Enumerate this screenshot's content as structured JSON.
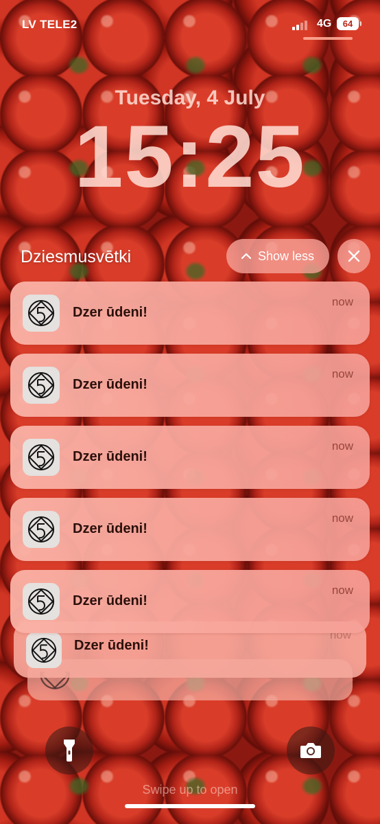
{
  "status_bar": {
    "carrier": "LV TELE2",
    "network": "4G",
    "battery": "64"
  },
  "lock_screen": {
    "date": "Tuesday, 4 July",
    "time": "15:25"
  },
  "notification_group": {
    "app_name": "Dziesmusvētki",
    "show_less_label": "Show less",
    "notifications": [
      {
        "message": "Dzer ūdeni!",
        "time": "now"
      },
      {
        "message": "Dzer ūdeni!",
        "time": "now"
      },
      {
        "message": "Dzer ūdeni!",
        "time": "now"
      },
      {
        "message": "Dzer ūdeni!",
        "time": "now"
      },
      {
        "message": "Dzer ūdeni!",
        "time": "now"
      },
      {
        "message": "Dzer ūdeni!",
        "time": "now"
      }
    ]
  },
  "bottom": {
    "swipe_hint": "Swipe up to open"
  },
  "icons": {
    "app": "dziesmusvetki-logo-icon",
    "flashlight": "flashlight-icon",
    "camera": "camera-icon",
    "close": "close-icon",
    "chevron": "chevron-up-icon"
  },
  "colors": {
    "notification_bg": "#f8a89a",
    "wallpaper_red": "#d93826"
  }
}
